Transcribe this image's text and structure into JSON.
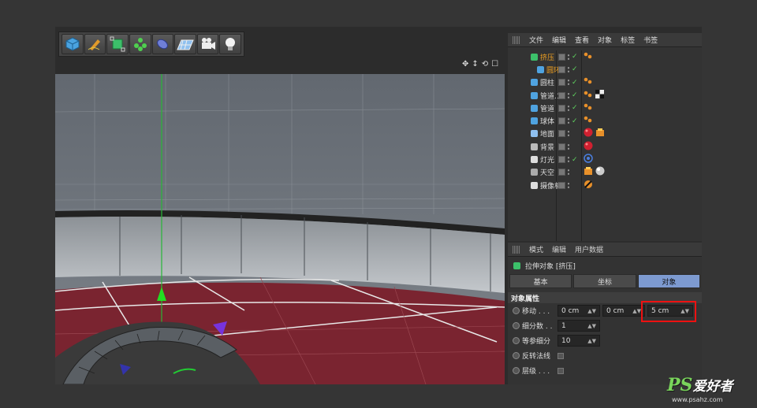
{
  "toolbar": {
    "icons": [
      "cube-icon",
      "pen-icon",
      "subdivision-icon",
      "cloner-icon",
      "deformer-icon",
      "floor-icon",
      "camera-icon",
      "light-icon"
    ]
  },
  "viewport": {
    "nav_icons": [
      "✥",
      "↕",
      "⟲",
      "☐"
    ]
  },
  "object_manager": {
    "menu": [
      "文件",
      "编辑",
      "查看",
      "对象",
      "标签",
      "书签"
    ],
    "objects": [
      {
        "name": "挤压",
        "active": true,
        "checked": true,
        "tags": [
          "phong"
        ]
      },
      {
        "name": "圆环",
        "active": true,
        "checked": true,
        "tags": [],
        "child": true
      },
      {
        "name": "圆柱",
        "active": false,
        "checked": true,
        "tags": [
          "phong"
        ]
      },
      {
        "name": "管道.1",
        "active": false,
        "checked": true,
        "tags": [
          "phong",
          "checker"
        ]
      },
      {
        "name": "管道",
        "active": false,
        "checked": true,
        "tags": [
          "phong"
        ]
      },
      {
        "name": "球体",
        "active": false,
        "checked": true,
        "tags": [
          "phong"
        ]
      },
      {
        "name": "地面",
        "active": false,
        "checked": false,
        "tags": [
          "material-red",
          "texture"
        ]
      },
      {
        "name": "背景",
        "active": false,
        "checked": false,
        "tags": [
          "material-red"
        ]
      },
      {
        "name": "灯光",
        "active": false,
        "checked": true,
        "tags": [
          "target"
        ]
      },
      {
        "name": "天空",
        "active": false,
        "checked": false,
        "tags": [
          "texture",
          "sky-material"
        ]
      },
      {
        "name": "摄像机",
        "active": false,
        "checked": false,
        "tags": [
          "protection"
        ]
      }
    ]
  },
  "attribute_manager": {
    "menu": [
      "模式",
      "编辑",
      "用户数据"
    ],
    "title": "拉伸对象 [挤压]",
    "tabs": [
      {
        "label": "基本",
        "active": false
      },
      {
        "label": "坐标",
        "active": false
      },
      {
        "label": "对象",
        "active": true
      }
    ],
    "section": "对象属性",
    "move": {
      "label": "移动 . . .",
      "x": "0 cm",
      "y": "0 cm",
      "z": "5 cm"
    },
    "subdivision": {
      "label": "细分数 . .",
      "value": "1"
    },
    "iso": {
      "label": "等参细分",
      "value": "10"
    },
    "flip": {
      "label": "反转法线"
    },
    "hierarchical": {
      "label": "层级 . . ."
    }
  },
  "watermark": {
    "logo": "PS",
    "text": "爱好者",
    "url": "www.psahz.com"
  },
  "colors": {
    "active_tab": "#7d9ad0",
    "highlight_box": "#e11111",
    "check": "#5fd35f",
    "active_object": "#f0a020",
    "floor": "#7a2430"
  }
}
